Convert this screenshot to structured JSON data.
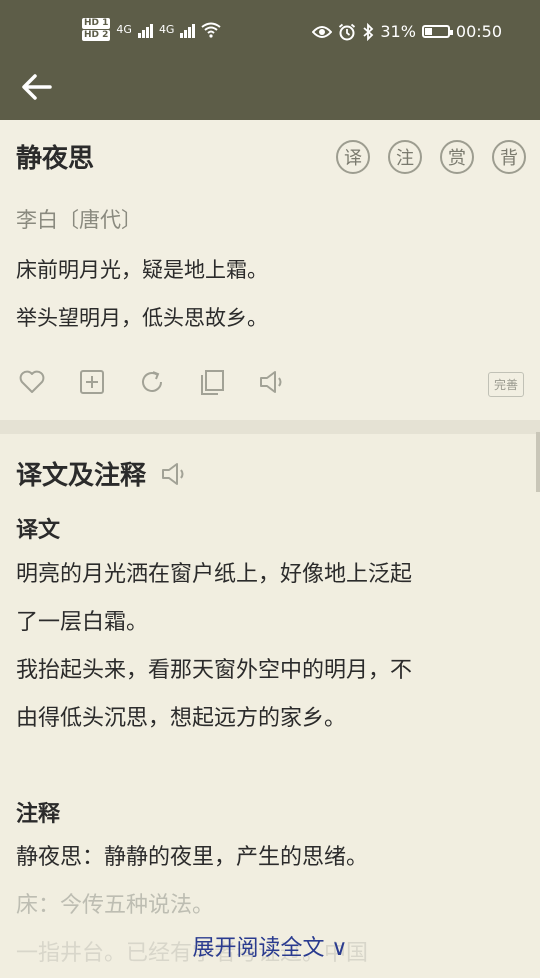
{
  "status_bar": {
    "hd1": "HD 1",
    "hd2": "HD 2",
    "net1": "4G",
    "net2": "4G",
    "battery_percent": "31%",
    "battery_level": 0.31,
    "time": "00:50"
  },
  "toolbar": {
    "back_icon": "arrow-left-icon"
  },
  "poem": {
    "title": "静夜思",
    "chips": [
      "译",
      "注",
      "赏",
      "背"
    ],
    "author": "李白〔唐代〕",
    "lines": [
      "床前明月光，疑是地上霜。",
      "举头望明月，低头思故乡。"
    ],
    "actions": [
      "heart-icon",
      "plus-box-icon",
      "refresh-icon",
      "copy-icon",
      "speaker-icon"
    ],
    "complete_label": "完善"
  },
  "section": {
    "title": "译文及注释",
    "translation_heading": "译文",
    "translation_lines": [
      "明亮的月光洒在窗户纸上，好像地上泛起",
      "了一层白霜。",
      "我抬起头来，看那天窗外空中的明月，不",
      "由得低头沉思，想起远方的家乡。"
    ],
    "notes_heading": "注释",
    "notes_lines": [
      "静夜思：静静的夜里，产生的思绪。",
      "床：今传五种说法。",
      "一指井台。已经有学者考证过。中国"
    ],
    "expand_label": "展开阅读全文 ∨"
  },
  "colors": {
    "header": "#5d5d48",
    "background": "#f1eee0",
    "link": "#2a3b8f"
  }
}
